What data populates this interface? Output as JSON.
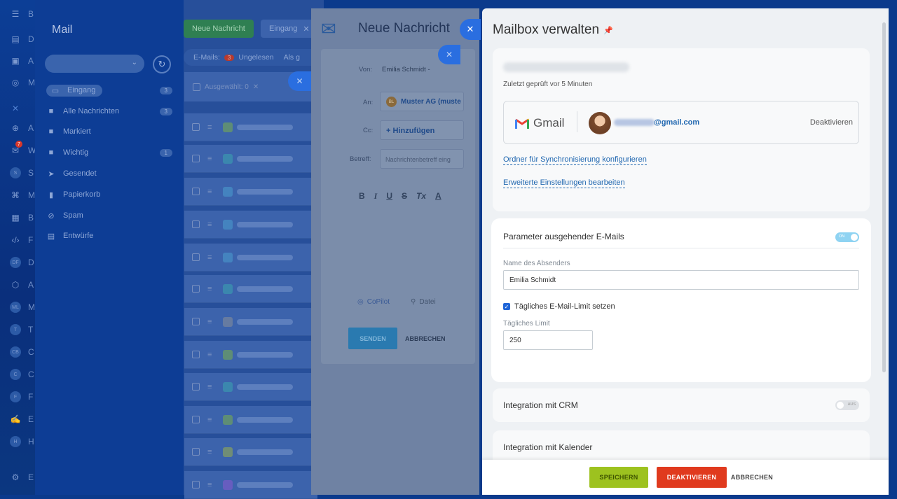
{
  "app_bar": {
    "items": [
      {
        "icon": "menu-icon",
        "label": "B"
      },
      {
        "icon": "grid-icon",
        "label": "D"
      },
      {
        "icon": "inbox-icon",
        "label": "A"
      },
      {
        "icon": "target-icon",
        "label": "M"
      },
      {
        "icon": "close-icon",
        "label": ""
      },
      {
        "icon": "globe-icon",
        "label": "A"
      },
      {
        "icon": "mail-icon",
        "label": "W",
        "badge": "7"
      },
      {
        "icon": "circle-s",
        "label": "S"
      },
      {
        "icon": "chart-icon",
        "label": "M"
      },
      {
        "icon": "building-icon",
        "label": "B"
      },
      {
        "icon": "code-icon",
        "label": "F"
      },
      {
        "icon": "circle-df",
        "label": "D"
      },
      {
        "icon": "cube-icon",
        "label": "A"
      },
      {
        "icon": "circle-ml",
        "label": "M"
      },
      {
        "icon": "circle-t",
        "label": "T"
      },
      {
        "icon": "circle-cb",
        "label": "C"
      },
      {
        "icon": "circle-c",
        "label": "C"
      },
      {
        "icon": "circle-f",
        "label": "F"
      },
      {
        "icon": "sign-icon",
        "label": "E"
      },
      {
        "icon": "circle-h",
        "label": "H"
      },
      {
        "icon": "settings-icon",
        "label": "E"
      }
    ],
    "circle_texts": {
      "s": "S",
      "df": "DF",
      "ml": "ML",
      "t": "T",
      "cb": "CB",
      "c": "C",
      "f": "F",
      "h": "H"
    }
  },
  "mail_sidebar": {
    "title": "Mail",
    "folders": [
      {
        "label": "Eingang",
        "count": "3",
        "icon": "inbox-icon"
      },
      {
        "label": "Alle Nachrichten",
        "count": "3",
        "icon": "folder-icon"
      },
      {
        "label": "Markiert",
        "count": "",
        "icon": "folder-icon"
      },
      {
        "label": "Wichtig",
        "count": "1",
        "icon": "folder-icon"
      },
      {
        "label": "Gesendet",
        "count": "",
        "icon": "sent-icon"
      },
      {
        "label": "Papierkorb",
        "count": "",
        "icon": "trash-icon"
      },
      {
        "label": "Spam",
        "count": "",
        "icon": "spam-icon"
      },
      {
        "label": "Entwürfe",
        "count": "",
        "icon": "draft-icon"
      }
    ]
  },
  "mail_list": {
    "new_message_button": "Neue Nachricht",
    "filter_chip": "Eingang",
    "emails_label": "E-Mails:",
    "unread_count": "3",
    "unread_label": "Ungelesen",
    "as_label": "Als g",
    "selected_label": "Ausgewählt: 0",
    "row_colors": [
      "#7ab04a",
      "#3aa6b0",
      "#4a9fd0",
      "#4a9fd0",
      "#4a9fd0",
      "#3aa6b0",
      "#888f99",
      "#7ab04a",
      "#3aa6b0",
      "#7ab04a",
      "#9ab04a",
      "#8a5ad0"
    ]
  },
  "compose": {
    "title": "Neue Nachricht",
    "from_label": "Von:",
    "from_value": "Emilia Schmidt -",
    "to_label": "An:",
    "to_value": "Muster AG (muste",
    "to_avatar": "BL",
    "cc_label": "Cc:",
    "cc_add": "+ Hinzufügen",
    "subject_label": "Betreff:",
    "subject_placeholder": "Nachrichtenbetreff eing",
    "format_bold": "B",
    "format_italic": "I",
    "format_underline": "U",
    "format_strike": "S",
    "format_clear": "Tx",
    "format_color": "A",
    "copilot_label": "CoPilot",
    "file_label": "Datei",
    "send_button": "SENDEN",
    "cancel_button": "ABBRECHEN"
  },
  "panel": {
    "title": "Mailbox verwalten",
    "last_checked": "Zuletzt geprüft vor 5 Minuten",
    "gmail_label": "Gmail",
    "account_suffix": "@gmail.com",
    "deactivate_link": "Deaktivieren",
    "sync_link": "Ordner für Synchronisierung konfigurieren",
    "advanced_link": "Erweiterte Einstellungen bearbeiten",
    "outgoing": {
      "title": "Parameter ausgehender E-Mails",
      "toggle_state": "ON",
      "sender_name_label": "Name des Absenders",
      "sender_name_value": "Emilia Schmidt",
      "limit_checkbox_label": "Tägliches E-Mail-Limit setzen",
      "limit_checked": true,
      "daily_limit_label": "Tägliches Limit",
      "daily_limit_value": "250"
    },
    "crm": {
      "title": "Integration mit CRM",
      "toggle_state": "AUS"
    },
    "calendar": {
      "title": "Integration mit Kalender"
    },
    "footer": {
      "save_button": "SPEICHERN",
      "deactivate_button": "DEAKTIVIEREN",
      "cancel_button": "ABBRECHEN"
    },
    "colors": {
      "save": "#9dc21f",
      "deactivate": "#e03a1e",
      "link": "#2067b0",
      "toggle_on": "#8fd3f2"
    }
  }
}
